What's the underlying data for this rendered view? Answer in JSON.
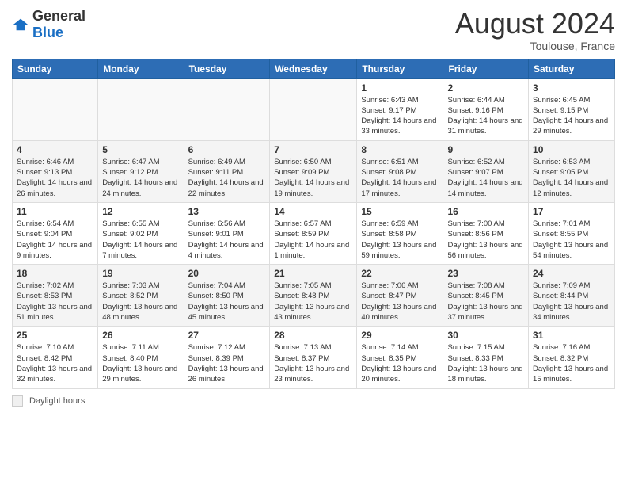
{
  "header": {
    "logo_general": "General",
    "logo_blue": "Blue",
    "month_year": "August 2024",
    "location": "Toulouse, France"
  },
  "columns": [
    "Sunday",
    "Monday",
    "Tuesday",
    "Wednesday",
    "Thursday",
    "Friday",
    "Saturday"
  ],
  "weeks": [
    [
      {
        "day": "",
        "info": ""
      },
      {
        "day": "",
        "info": ""
      },
      {
        "day": "",
        "info": ""
      },
      {
        "day": "",
        "info": ""
      },
      {
        "day": "1",
        "info": "Sunrise: 6:43 AM\nSunset: 9:17 PM\nDaylight: 14 hours and 33 minutes."
      },
      {
        "day": "2",
        "info": "Sunrise: 6:44 AM\nSunset: 9:16 PM\nDaylight: 14 hours and 31 minutes."
      },
      {
        "day": "3",
        "info": "Sunrise: 6:45 AM\nSunset: 9:15 PM\nDaylight: 14 hours and 29 minutes."
      }
    ],
    [
      {
        "day": "4",
        "info": "Sunrise: 6:46 AM\nSunset: 9:13 PM\nDaylight: 14 hours and 26 minutes."
      },
      {
        "day": "5",
        "info": "Sunrise: 6:47 AM\nSunset: 9:12 PM\nDaylight: 14 hours and 24 minutes."
      },
      {
        "day": "6",
        "info": "Sunrise: 6:49 AM\nSunset: 9:11 PM\nDaylight: 14 hours and 22 minutes."
      },
      {
        "day": "7",
        "info": "Sunrise: 6:50 AM\nSunset: 9:09 PM\nDaylight: 14 hours and 19 minutes."
      },
      {
        "day": "8",
        "info": "Sunrise: 6:51 AM\nSunset: 9:08 PM\nDaylight: 14 hours and 17 minutes."
      },
      {
        "day": "9",
        "info": "Sunrise: 6:52 AM\nSunset: 9:07 PM\nDaylight: 14 hours and 14 minutes."
      },
      {
        "day": "10",
        "info": "Sunrise: 6:53 AM\nSunset: 9:05 PM\nDaylight: 14 hours and 12 minutes."
      }
    ],
    [
      {
        "day": "11",
        "info": "Sunrise: 6:54 AM\nSunset: 9:04 PM\nDaylight: 14 hours and 9 minutes."
      },
      {
        "day": "12",
        "info": "Sunrise: 6:55 AM\nSunset: 9:02 PM\nDaylight: 14 hours and 7 minutes."
      },
      {
        "day": "13",
        "info": "Sunrise: 6:56 AM\nSunset: 9:01 PM\nDaylight: 14 hours and 4 minutes."
      },
      {
        "day": "14",
        "info": "Sunrise: 6:57 AM\nSunset: 8:59 PM\nDaylight: 14 hours and 1 minute."
      },
      {
        "day": "15",
        "info": "Sunrise: 6:59 AM\nSunset: 8:58 PM\nDaylight: 13 hours and 59 minutes."
      },
      {
        "day": "16",
        "info": "Sunrise: 7:00 AM\nSunset: 8:56 PM\nDaylight: 13 hours and 56 minutes."
      },
      {
        "day": "17",
        "info": "Sunrise: 7:01 AM\nSunset: 8:55 PM\nDaylight: 13 hours and 54 minutes."
      }
    ],
    [
      {
        "day": "18",
        "info": "Sunrise: 7:02 AM\nSunset: 8:53 PM\nDaylight: 13 hours and 51 minutes."
      },
      {
        "day": "19",
        "info": "Sunrise: 7:03 AM\nSunset: 8:52 PM\nDaylight: 13 hours and 48 minutes."
      },
      {
        "day": "20",
        "info": "Sunrise: 7:04 AM\nSunset: 8:50 PM\nDaylight: 13 hours and 45 minutes."
      },
      {
        "day": "21",
        "info": "Sunrise: 7:05 AM\nSunset: 8:48 PM\nDaylight: 13 hours and 43 minutes."
      },
      {
        "day": "22",
        "info": "Sunrise: 7:06 AM\nSunset: 8:47 PM\nDaylight: 13 hours and 40 minutes."
      },
      {
        "day": "23",
        "info": "Sunrise: 7:08 AM\nSunset: 8:45 PM\nDaylight: 13 hours and 37 minutes."
      },
      {
        "day": "24",
        "info": "Sunrise: 7:09 AM\nSunset: 8:44 PM\nDaylight: 13 hours and 34 minutes."
      }
    ],
    [
      {
        "day": "25",
        "info": "Sunrise: 7:10 AM\nSunset: 8:42 PM\nDaylight: 13 hours and 32 minutes."
      },
      {
        "day": "26",
        "info": "Sunrise: 7:11 AM\nSunset: 8:40 PM\nDaylight: 13 hours and 29 minutes."
      },
      {
        "day": "27",
        "info": "Sunrise: 7:12 AM\nSunset: 8:39 PM\nDaylight: 13 hours and 26 minutes."
      },
      {
        "day": "28",
        "info": "Sunrise: 7:13 AM\nSunset: 8:37 PM\nDaylight: 13 hours and 23 minutes."
      },
      {
        "day": "29",
        "info": "Sunrise: 7:14 AM\nSunset: 8:35 PM\nDaylight: 13 hours and 20 minutes."
      },
      {
        "day": "30",
        "info": "Sunrise: 7:15 AM\nSunset: 8:33 PM\nDaylight: 13 hours and 18 minutes."
      },
      {
        "day": "31",
        "info": "Sunrise: 7:16 AM\nSunset: 8:32 PM\nDaylight: 13 hours and 15 minutes."
      }
    ]
  ],
  "legend": {
    "box_label": "Daylight hours"
  }
}
